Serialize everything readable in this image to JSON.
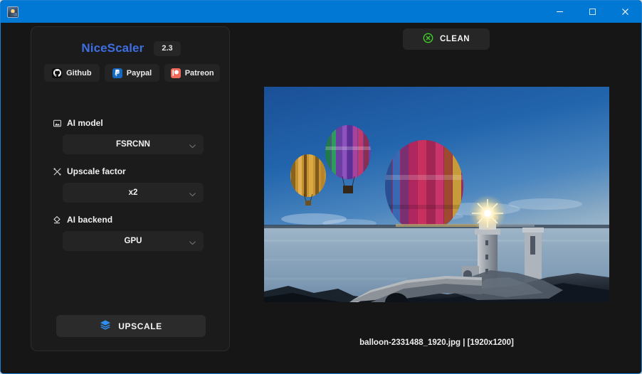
{
  "titlebar": {
    "app_icon": "app-icon",
    "minimize_label": "–",
    "maximize_label": "❐",
    "close_label": "✕"
  },
  "sidebar": {
    "brand": "NiceScaler",
    "version": "2.3",
    "brand_color": "#3d6fe3",
    "social": [
      {
        "label": "Github",
        "icon": "github-icon"
      },
      {
        "label": "Paypal",
        "icon": "paypal-icon"
      },
      {
        "label": "Patreon",
        "icon": "patreon-icon"
      }
    ],
    "options": [
      {
        "label": "AI model",
        "icon": "image-icon",
        "value": "FSRCNN"
      },
      {
        "label": "Upscale factor",
        "icon": "resize-icon",
        "value": "x2"
      },
      {
        "label": "AI backend",
        "icon": "chip-icon",
        "value": "GPU"
      }
    ],
    "upscale_button": {
      "label": "UPSCALE",
      "icon": "layers-icon",
      "icon_color": "#2f8ef0"
    }
  },
  "main": {
    "clean_button": {
      "label": "CLEAN",
      "icon": "circle-x-icon",
      "icon_color": "#3fcf27"
    },
    "preview": {
      "alt": "hot air balloons over a lighthouse at dusk",
      "caption": "balloon-2331488_1920.jpg | [1920x1200]"
    }
  }
}
